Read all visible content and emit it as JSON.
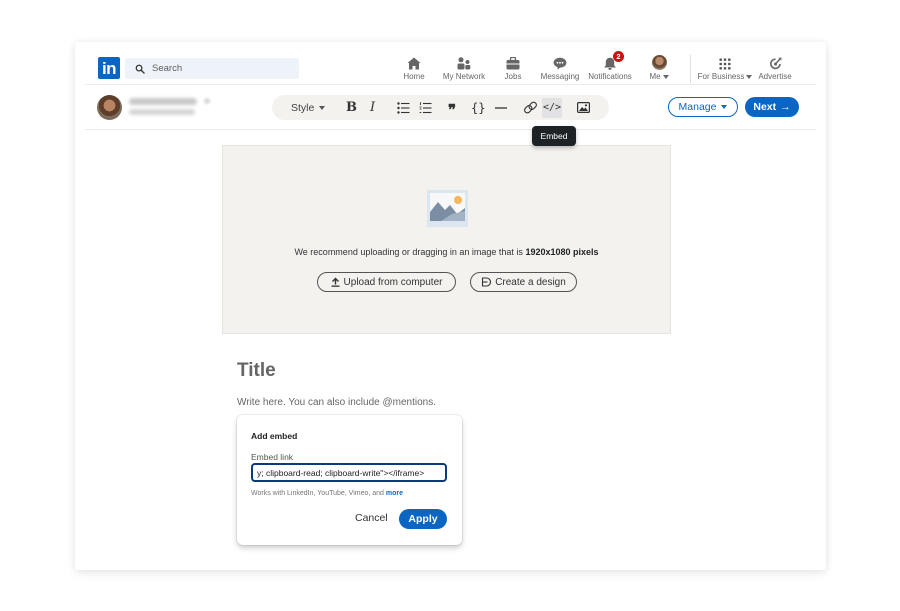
{
  "nav": {
    "logo": "in",
    "search_placeholder": "Search",
    "items": [
      {
        "label": "Home",
        "icon": "home-icon"
      },
      {
        "label": "My Network",
        "icon": "network-icon"
      },
      {
        "label": "Jobs",
        "icon": "briefcase-icon"
      },
      {
        "label": "Messaging",
        "icon": "messaging-icon"
      },
      {
        "label": "Notifications",
        "icon": "bell-icon",
        "badge": "2"
      },
      {
        "label": "Me",
        "icon": "avatar"
      },
      {
        "label": "For Business",
        "icon": "grid-icon"
      },
      {
        "label": "Advertise",
        "icon": "advertise-icon"
      }
    ]
  },
  "editor": {
    "toolbar": {
      "style_label": "Style",
      "bold": "B",
      "italic": "I",
      "quote": "❞",
      "code": "{}",
      "embed": "</>",
      "embed_tooltip": "Embed"
    },
    "manage_label": "Manage",
    "next_label": "Next",
    "next_arrow": "→"
  },
  "cover": {
    "recommend_text": "We recommend uploading or dragging in an image that is ",
    "recommend_size": "1920x1080 pixels",
    "upload_label": "Upload from computer",
    "design_label": "Create a design"
  },
  "article": {
    "title_placeholder": "Title",
    "body_placeholder": "Write here. You can also include @mentions."
  },
  "embed_popup": {
    "title": "Add embed",
    "field_label": "Embed link",
    "field_value": "y; clipboard-read; clipboard-write\"></iframe>",
    "hint_text": "Works with LinkedIn, YouTube, Vimeo, and ",
    "hint_link": "more",
    "cancel_label": "Cancel",
    "apply_label": "Apply"
  },
  "colors": {
    "brand_blue": "#0a66c2",
    "badge_red": "#cc1016",
    "tooltip_bg": "#1d2226",
    "cover_bg": "#f3f2ef"
  }
}
